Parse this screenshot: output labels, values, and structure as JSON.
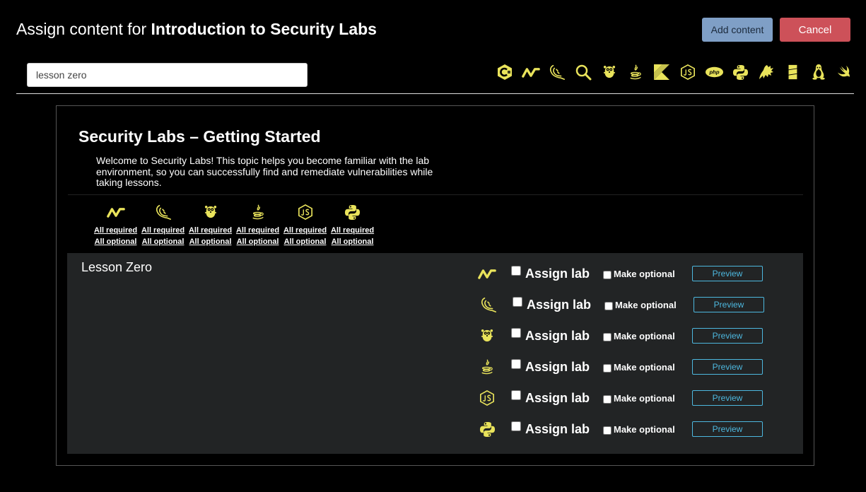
{
  "header": {
    "title_prefix": "Assign content for ",
    "title_bold": "Introduction to Security Labs",
    "add_label": "Add content",
    "cancel_label": "Cancel"
  },
  "search": {
    "value": "lesson zero",
    "placeholder": ""
  },
  "filters": [
    {
      "icon": "csharp-icon"
    },
    {
      "icon": "nodejs-icon"
    },
    {
      "icon": "scala-icon"
    },
    {
      "icon": "search-icon"
    },
    {
      "icon": "go-icon"
    },
    {
      "icon": "java-icon"
    },
    {
      "icon": "kotlin-icon"
    },
    {
      "icon": "javascript-icon"
    },
    {
      "icon": "php-icon"
    },
    {
      "icon": "python-icon"
    },
    {
      "icon": "ruby-icon"
    },
    {
      "icon": "sql-icon"
    },
    {
      "icon": "linux-icon"
    },
    {
      "icon": "swift-icon"
    }
  ],
  "topic": {
    "title": "Security Labs – Getting Started",
    "description": "Welcome to Security Labs! This topic helps you become familiar with the lab environment, so you can successfully find and remediate vulnerabilities while taking lessons.",
    "groups": [
      {
        "icon": "nodejs-icon",
        "required": "All required",
        "optional": "All optional"
      },
      {
        "icon": "scala-icon",
        "required": "All required",
        "optional": "All optional"
      },
      {
        "icon": "go-icon",
        "required": "All required",
        "optional": "All optional"
      },
      {
        "icon": "java-icon",
        "required": "All required",
        "optional": "All optional"
      },
      {
        "icon": "javascript-icon",
        "required": "All required",
        "optional": "All optional"
      },
      {
        "icon": "python-icon",
        "required": "All required",
        "optional": "All optional"
      }
    ]
  },
  "lesson": {
    "name": "Lesson Zero",
    "labs": [
      {
        "icon": "nodejs-icon",
        "assign": "Assign lab",
        "optional": "Make optional",
        "preview": "Preview"
      },
      {
        "icon": "scala-icon",
        "assign": "Assign lab",
        "optional": "Make optional",
        "preview": "Preview"
      },
      {
        "icon": "go-icon",
        "assign": "Assign lab",
        "optional": "Make optional",
        "preview": "Preview"
      },
      {
        "icon": "java-icon",
        "assign": "Assign lab",
        "optional": "Make optional",
        "preview": "Preview"
      },
      {
        "icon": "javascript-icon",
        "assign": "Assign lab",
        "optional": "Make optional",
        "preview": "Preview"
      },
      {
        "icon": "python-icon",
        "assign": "Assign lab",
        "optional": "Make optional",
        "preview": "Preview"
      }
    ]
  },
  "colors": {
    "icon": "#e9e35b",
    "preview": "#4db8df",
    "add": "#7f9fc6",
    "cancel": "#cd5159",
    "lesson_bg": "#222425"
  }
}
